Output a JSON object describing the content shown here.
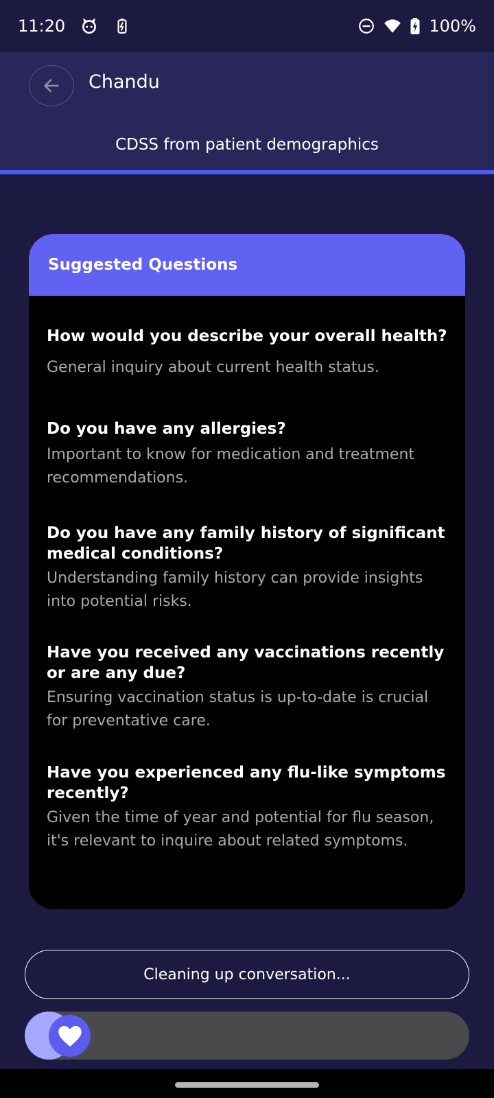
{
  "status_bar": {
    "time": "11:20",
    "battery": "100%",
    "icons": [
      "cat-face-icon",
      "battery-saver-icon",
      "do-not-disturb-icon",
      "wifi-icon",
      "battery-charging-icon"
    ]
  },
  "header": {
    "contact_name": "Chandu",
    "subtitle": "CDSS from patient demographics",
    "accent_color": "#4a5cf0"
  },
  "card": {
    "title": "Suggested Questions",
    "header_color": "#6161f2",
    "questions": [
      {
        "title": "How would you describe your overall health?",
        "description": "General inquiry about current health status."
      },
      {
        "title": "Do you have any allergies?",
        "description": "Important to know for medication and treatment recommendations."
      },
      {
        "title": "Do you have any family history of significant medical conditions?",
        "description": "Understanding family history can provide insights into potential risks."
      },
      {
        "title": "Have you received any vaccinations recently or are any due?",
        "description": "Ensuring vaccination status is up-to-date is crucial for preventative care."
      },
      {
        "title": "Have you experienced any flu-like symptoms recently?",
        "description": "Given the time of year and potential for flu season, it's relevant to inquire about related symptoms."
      }
    ]
  },
  "actions": {
    "cleanup_label": "Cleaning up conversation...",
    "slider_icon": "heart-icon",
    "slider_progress": 0
  }
}
